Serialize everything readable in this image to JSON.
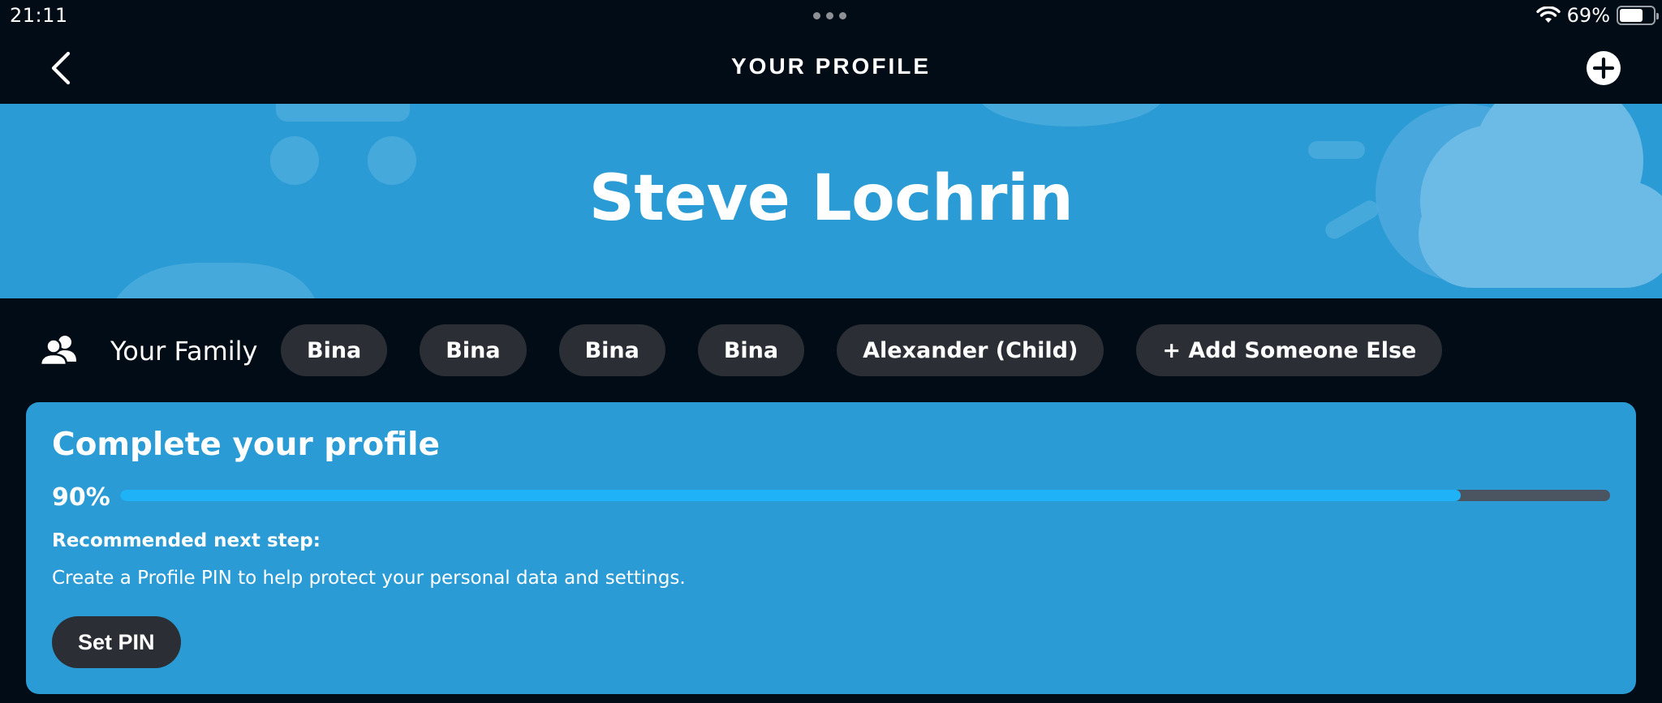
{
  "status_bar": {
    "time": "21:11",
    "battery_percent": "69%",
    "battery_level": 0.69,
    "icons": [
      "multitasking-dots-icon",
      "wifi-icon",
      "battery-icon"
    ]
  },
  "nav": {
    "title": "YOUR PROFILE",
    "back_icon": "chevron-left-icon",
    "add_icon": "plus-circle-icon"
  },
  "hero": {
    "name": "Steve Lochrin"
  },
  "family": {
    "label": "Your Family",
    "icon": "people-icon",
    "members": [
      {
        "label": "Bina"
      },
      {
        "label": "Bina"
      },
      {
        "label": "Bina"
      },
      {
        "label": "Bina"
      },
      {
        "label": "Alexander (Child)"
      }
    ],
    "add_label": "+ Add Someone Else"
  },
  "profile_card": {
    "title": "Complete your profile",
    "progress_label": "90%",
    "progress_value": 0.9,
    "next_step_heading": "Recommended next step:",
    "next_step_text": "Create a Profile PIN to help protect your personal data and settings.",
    "button_label": "Set PIN"
  },
  "colors": {
    "background": "#020c16",
    "accent_blue": "#2a9bd4",
    "progress_fill": "#1fb2f7",
    "progress_track": "#4b5562",
    "chip_bg": "#2b2f35"
  }
}
